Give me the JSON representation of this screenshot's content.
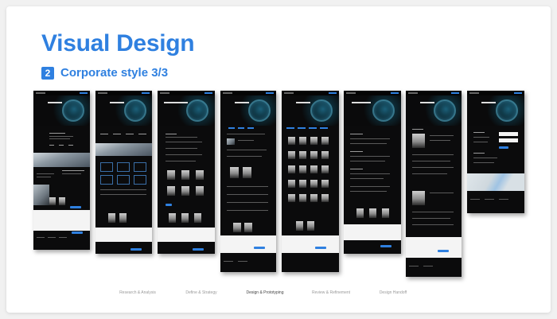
{
  "slide": {
    "title": "Visual Design",
    "step_number": "2",
    "subtitle": "Corporate style 3/3"
  },
  "mockups": [
    {
      "heading": "ABOUT US"
    },
    {
      "heading": "PRACTICES"
    },
    {
      "heading": "INVESTIGATION AND LITIGATION"
    },
    {
      "heading": "PEOPLE"
    },
    {
      "heading": "OUR TEAM"
    },
    {
      "heading": "OUR SUCCESSES"
    },
    {
      "heading": "OUR TEAM"
    },
    {
      "heading": "CONTACTS"
    }
  ],
  "phases": [
    {
      "label": "Research & Analysis",
      "active": false
    },
    {
      "label": "Define & Strategy",
      "active": false
    },
    {
      "label": "Design & Prototyping",
      "active": true
    },
    {
      "label": "Review & Refinement",
      "active": false
    },
    {
      "label": "Design Handoff",
      "active": false
    }
  ],
  "colors": {
    "accent": "#2f80e0",
    "mock_background": "#0b0b0c",
    "slide_background": "#ffffff"
  }
}
